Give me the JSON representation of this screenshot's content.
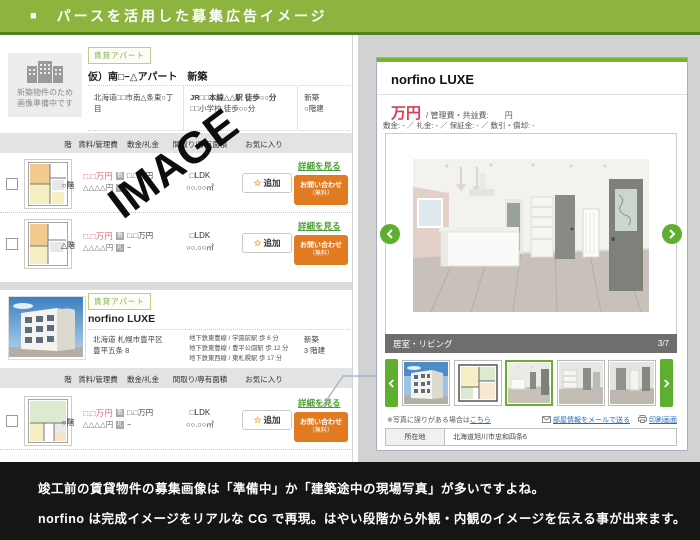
{
  "header": {
    "bullet": "■",
    "title": "パースを活用した募集広告イメージ"
  },
  "colors": {
    "accent_green": "#8cb43e",
    "button_orange": "#e17b21",
    "price_red": "#dd3a55",
    "link_green": "#4a9e2f",
    "link_blue": "#2a6db5",
    "selected_thumb_green": "#6cae2c"
  },
  "watermark": "IMAGE",
  "listing1": {
    "placeholder_line1": "新築物件のため",
    "placeholder_line2": "画像準備中です",
    "badge": "賃貸アパート",
    "title": "仮）南□−△アパート　新築",
    "address": "北海道□□市南△条東○丁目",
    "access_line1": "JR□□本線△△駅 徒歩○○分",
    "access_line2": "□□小学校 徒歩○○分",
    "built": "新築",
    "floors": "○階建"
  },
  "listing2": {
    "badge": "賃貸アパート",
    "title": "norfino LUXE",
    "address_line1": "北海道 札幌市豊平区",
    "address_line2": "豊平五条 8",
    "access_line1": "地下鉄東豊線 / 学園前駅 歩 6 分",
    "access_line2": "地下鉄東豊線 / 豊平公園駅 歩 12 分",
    "access_line3": "地下鉄東西線 / 東札幌駅 歩 17 分",
    "built": "新築",
    "floors": "3 階建"
  },
  "table_header": {
    "floor": "階",
    "rent": "賃料/管理費",
    "deposit": "敷金/礼金",
    "layout": "間取り/専有面積",
    "favorite": "お気に入り"
  },
  "rows": [
    {
      "floor": "○階",
      "rent": "□.□万円",
      "admin": "△△△△円",
      "deposit_tag": "敷",
      "deposit": "□.□万円",
      "key_tag": "礼",
      "key": "−",
      "layout": "□LDK",
      "area": "○○.○○㎡",
      "add_label": "追加",
      "star": "☆",
      "detail_label": "詳細を見る",
      "contact_label": "お問い合わせ",
      "contact_sub": "（無料）"
    },
    {
      "floor": "△階",
      "rent": "□.□万円",
      "admin": "△△△△円",
      "deposit_tag": "敷",
      "deposit": "□.□万円",
      "key_tag": "礼",
      "key": "−",
      "layout": "□LDK",
      "area": "○○.○○㎡",
      "add_label": "追加",
      "star": "☆",
      "detail_label": "詳細を見る",
      "contact_label": "お問い合わせ",
      "contact_sub": "（無料）"
    },
    {
      "floor": "○階",
      "rent": "□.□万円",
      "admin": "△△△△円",
      "deposit_tag": "敷",
      "deposit": "□.□万円",
      "key_tag": "礼",
      "key": "−",
      "layout": "□LDK",
      "area": "○○.○○㎡",
      "add_label": "追加",
      "star": "☆",
      "detail_label": "詳細を見る",
      "contact_label": "お問い合わせ",
      "contact_sub": "（無料）"
    }
  ],
  "detail": {
    "title": "norfino LUXE",
    "price_unit": "万円",
    "price_note": "/ 管理費・共益費:",
    "price_note2": "円",
    "fees": "敷金: - ／ 礼金: - ／ 保証金: - ／ 敷引・償却: -",
    "caption": "居室・リビング",
    "counter": "3/7",
    "photo_note_prefix": "※写真に誤りがある場合は",
    "photo_note_link": "こちら",
    "mail_link": "部屋情報をメールで送る",
    "print_link": "印刷画面",
    "location_label": "所在地",
    "location_value": "北海道旭川市忠和四条6"
  },
  "footer": {
    "line1": "竣工前の賃貸物件の募集画像は「準備中」か「建築途中の現場写真」が多いですよね。",
    "line2": "norfino は完成イメージをリアルな CG で再現。はやい段階から外観・内観のイメージを伝える事が出来ます。"
  }
}
